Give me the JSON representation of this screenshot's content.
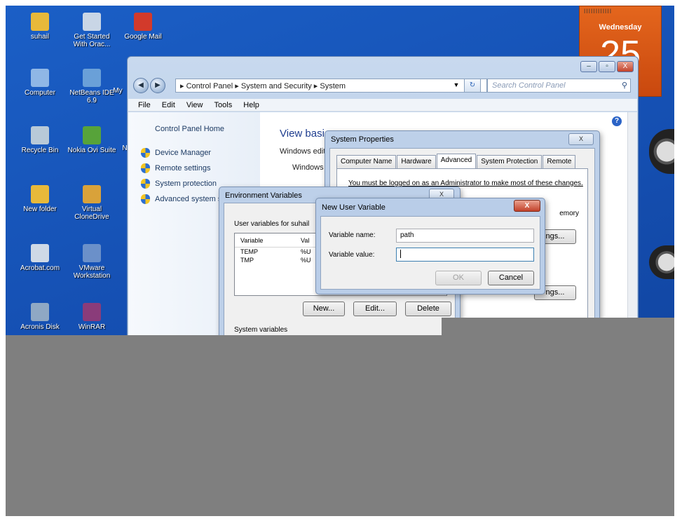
{
  "desktop": {
    "icons": [
      {
        "label": "suhail",
        "icon": "user-folder-icon",
        "color": "#e8b93a"
      },
      {
        "label": "Get Started With Orac...",
        "icon": "oracle-db-icon",
        "color": "#c9d6e6"
      },
      {
        "label": "Google Mail",
        "icon": "gmail-icon",
        "color": "#d23a2b"
      },
      {
        "label": "Computer",
        "icon": "computer-icon",
        "color": "#8fb7e6"
      },
      {
        "label": "NetBeans IDE 6.9",
        "icon": "netbeans-icon",
        "color": "#6aa0d8"
      },
      {
        "label": "My",
        "icon": "folder-icon",
        "color": "#e8b93a"
      },
      {
        "label": "Recycle Bin",
        "icon": "recycle-bin-icon",
        "color": "#b8c9d8"
      },
      {
        "label": "Nokia Ovi Suite",
        "icon": "nokia-ovi-icon",
        "color": "#57a33a"
      },
      {
        "label": "N",
        "icon": "app-icon",
        "color": "#5b8fd0"
      },
      {
        "label": "New folder",
        "icon": "folder-icon",
        "color": "#e8b93a"
      },
      {
        "label": "Virtual CloneDrive",
        "icon": "virtual-clonedrive-icon",
        "color": "#d9a23a"
      },
      {
        "label": "Acrobat.com",
        "icon": "acrobat-icon",
        "color": "#cfd9e6"
      },
      {
        "label": "VMware Workstation",
        "icon": "vmware-icon",
        "color": "#6b90c9"
      },
      {
        "label": "Acronis Disk",
        "icon": "acronis-icon",
        "color": "#8fa8c4"
      },
      {
        "label": "WinRAR",
        "icon": "winrar-icon",
        "color": "#8a3c7a"
      }
    ]
  },
  "calendar": {
    "rings": "||||||||||||",
    "day": "Wednesday",
    "date": "25"
  },
  "window": {
    "caption_buttons": [
      "–",
      "▫",
      "X"
    ],
    "back_glyph": "◀",
    "forward_glyph": "▶",
    "address": "▸ Control Panel ▸ System and Security ▸ System",
    "address_dropdown": "▼",
    "refresh_glyph": "↻",
    "search_placeholder": "Search Control Panel",
    "search_glyph": "⚲",
    "menu": [
      "File",
      "Edit",
      "View",
      "Tools",
      "Help"
    ],
    "left_pane": {
      "home": "Control Panel Home",
      "tasks": [
        "Device Manager",
        "Remote settings",
        "System protection",
        "Advanced system s"
      ]
    },
    "content": {
      "heading": "View basic",
      "edition_label": "Windows editi",
      "edition_value": "Windows 7",
      "help_glyph": "?"
    }
  },
  "system_properties": {
    "title": "System Properties",
    "close": "X",
    "tabs": [
      "Computer Name",
      "Hardware",
      "Advanced",
      "System Protection",
      "Remote"
    ],
    "active_tab": "Advanced",
    "admin_note": "You must be logged on as an Administrator to make most of these changes.",
    "memory_text": "emory",
    "settings_label": "ngs..."
  },
  "environment_variables": {
    "title": "Environment Variables",
    "close": "X",
    "user_vars_label": "User variables for suhail",
    "columns": [
      "Variable",
      "Val"
    ],
    "rows": [
      {
        "variable": "TEMP",
        "value": "%U"
      },
      {
        "variable": "TMP",
        "value": "%U"
      }
    ],
    "buttons": {
      "new": "New...",
      "edit": "Edit...",
      "delete": "Delete"
    },
    "system_vars_label": "System variables"
  },
  "new_user_variable": {
    "title": "New User Variable",
    "close": "X",
    "name_label": "Variable name:",
    "name_value": "path",
    "value_label": "Variable value:",
    "value_value": "",
    "ok": "OK",
    "cancel": "Cancel"
  }
}
